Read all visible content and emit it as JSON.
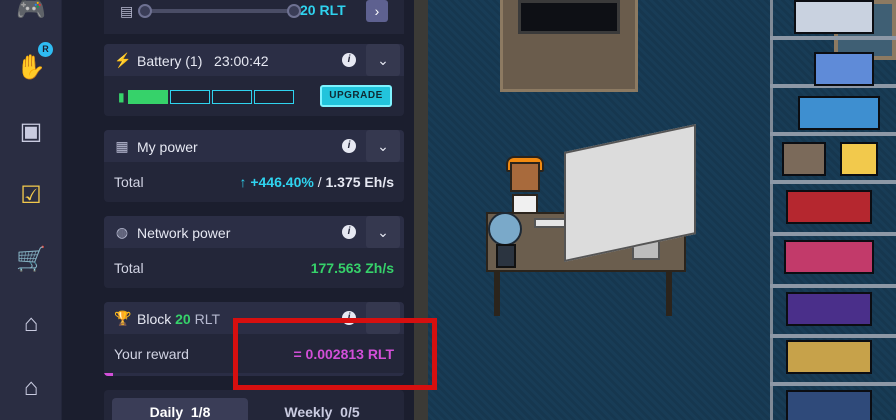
{
  "nav": {
    "badge_letter": "R",
    "icons": [
      "gamepad-icon",
      "rlt-hand-icon",
      "treasure-icon",
      "calendar-check-icon",
      "cart-icon",
      "market-icon",
      "house-icon"
    ]
  },
  "slider": {
    "value": "20 RLT",
    "next": "›"
  },
  "battery": {
    "title": "Battery (1)",
    "time": "23:00:42",
    "upgrade_label": "UPGRADE",
    "charge_segments_filled": 1,
    "charge_segments_total": 4
  },
  "my_power": {
    "title": "My power",
    "row_label": "Total",
    "change": "↑ +446.40%",
    "separator": "/",
    "value": "1.375 Eh/s"
  },
  "network_power": {
    "title": "Network power",
    "row_label": "Total",
    "value": "177.563 Zh/s"
  },
  "block": {
    "title_prefix": "Block",
    "amount": "20",
    "currency": "RLT",
    "row_label": "Your reward",
    "reward": "= 0.002813 RLT",
    "progress_fraction": 0.03
  },
  "tabs": [
    {
      "label": "Daily",
      "count": "1/8"
    },
    {
      "label": "Weekly",
      "count": "0/5"
    }
  ],
  "colors": {
    "accent_cyan": "#2fd3ef",
    "green": "#36d26a",
    "magenta": "#d24fd8",
    "highlight": "#d60f0f"
  },
  "info_glyph": "i",
  "chevron_glyph": "⌄"
}
